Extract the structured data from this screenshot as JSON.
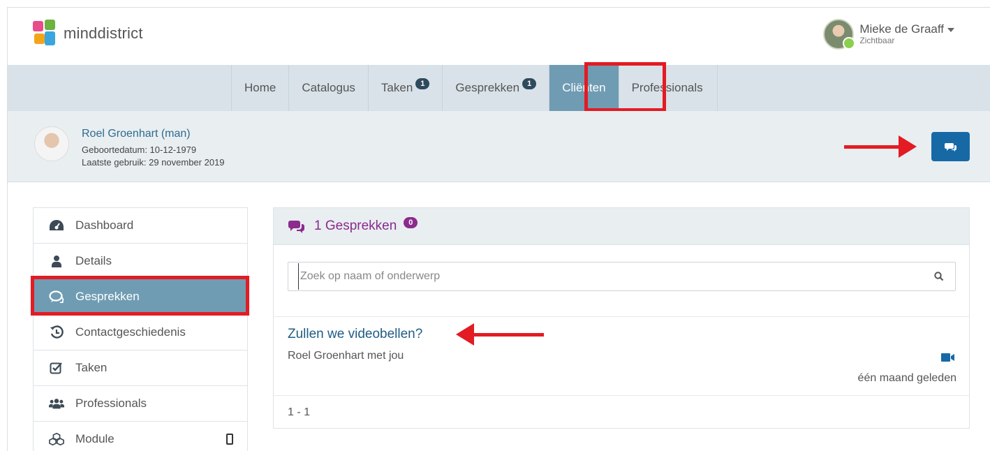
{
  "app": {
    "logo_text": "minddistrict",
    "logo_colors": [
      "#e74c8b",
      "#6cb33f",
      "#3aa6dd",
      "#f3a51a"
    ]
  },
  "user": {
    "name": "Mieke de Graaff",
    "status": "Zichtbaar"
  },
  "nav": {
    "items": [
      {
        "label": "Home",
        "badge": null
      },
      {
        "label": "Catalogus",
        "badge": null
      },
      {
        "label": "Taken",
        "badge": "1"
      },
      {
        "label": "Gesprekken",
        "badge": "1"
      },
      {
        "label": "Cliënten",
        "badge": null,
        "active": true
      },
      {
        "label": "Professionals",
        "badge": null
      }
    ]
  },
  "client": {
    "name": "Roel Groenhart (man)",
    "birthdate": "Geboortedatum: 10-12-1979",
    "last_use": "Laatste gebruik: 29 november 2019"
  },
  "sidebar": {
    "items": [
      {
        "label": "Dashboard",
        "icon": "dashboard-icon"
      },
      {
        "label": "Details",
        "icon": "user-icon"
      },
      {
        "label": "Gesprekken",
        "icon": "chat-icon",
        "active": true
      },
      {
        "label": "Contactgeschiedenis",
        "icon": "history-icon"
      },
      {
        "label": "Taken",
        "icon": "checkbox-icon"
      },
      {
        "label": "Professionals",
        "icon": "group-icon"
      },
      {
        "label": "Module",
        "icon": "cubes-icon"
      }
    ]
  },
  "panel": {
    "title": "1 Gesprekken",
    "badge": "0",
    "search_placeholder": "Zoek op naam of onderwerp",
    "conversation": {
      "subject": "Zullen we videobellen?",
      "participants": "Roel Groenhart met jou",
      "time": "één maand geleden"
    },
    "pager": "1 - 1"
  },
  "colors": {
    "accent": "#6f9cb3",
    "highlight": "#e31b23",
    "purple": "#8a2b8d",
    "primary": "#1769a6"
  }
}
